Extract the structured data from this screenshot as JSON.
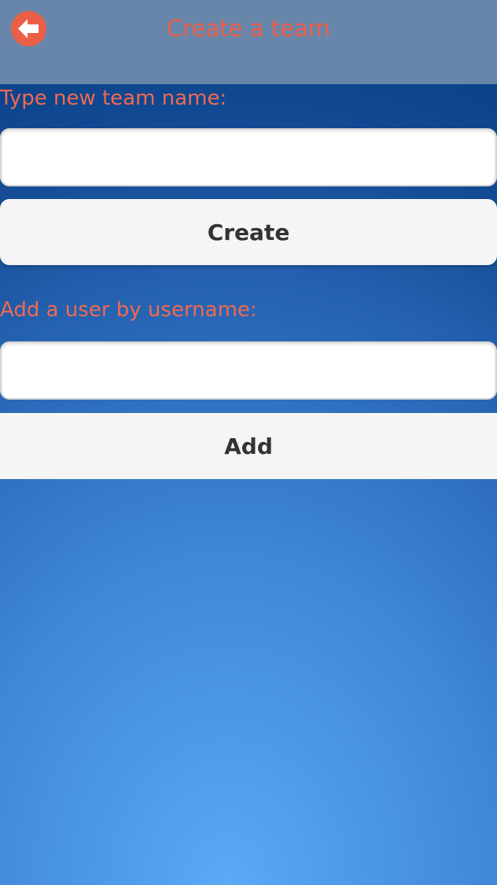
{
  "header": {
    "title": "Create a team",
    "back_icon": "arrow-left-circle-icon"
  },
  "create_team": {
    "label": "Type new team name:",
    "input_value": "",
    "button_label": "Create"
  },
  "add_user": {
    "label": "Add a user by username:",
    "input_value": "",
    "button_label": "Add"
  },
  "colors": {
    "header_bg": "#6886aa",
    "accent": "#ec5f47",
    "label_text": "#f06a50",
    "button_bg": "#f5f5f5",
    "gradient_light": "#5aaaf6",
    "gradient_dark": "#0b428a"
  }
}
